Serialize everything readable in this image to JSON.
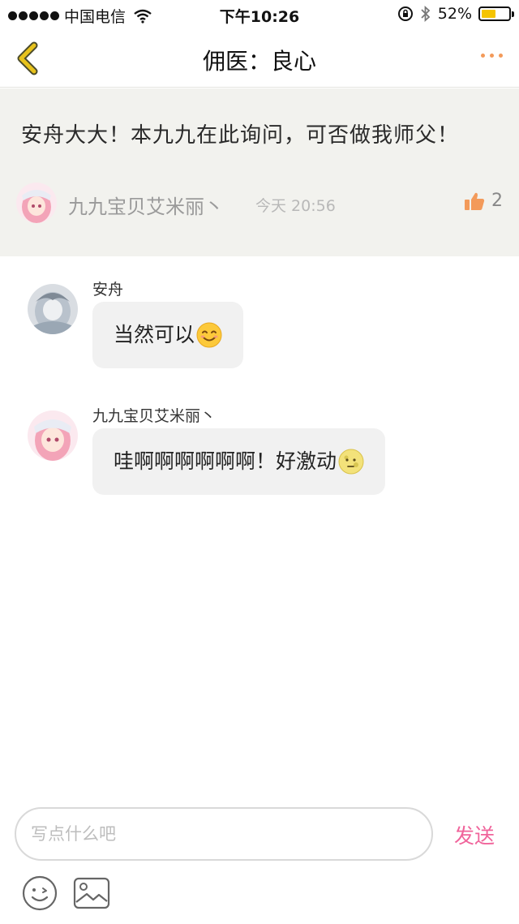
{
  "status_bar": {
    "carrier": "中国电信",
    "time": "下午10:26",
    "battery": "52%",
    "battery_level": 0.52
  },
  "nav": {
    "title": "佣医：良心"
  },
  "post": {
    "text": "安舟大大！本九九在此询问，可否做我师父！",
    "author": "九九宝贝艾米丽丶",
    "time": "今天 20:56",
    "likes": "2"
  },
  "messages": [
    {
      "name": "安舟",
      "text": "当然可以",
      "emoji": "smile-emoji"
    },
    {
      "name": "九九宝贝艾米丽丶",
      "text": "哇啊啊啊啊啊啊！好激动",
      "emoji": "moon-face-emoji"
    }
  ],
  "composer": {
    "placeholder": "写点什么吧",
    "send_label": "发送"
  },
  "icons": {
    "back": "chevron-left-icon",
    "more": "more-dots-icon",
    "like": "thumbs-up-icon",
    "emoji": "emoji-face-icon",
    "image": "image-icon"
  },
  "colors": {
    "accent_orange": "#f39a5a",
    "send_pink": "#f0649b",
    "post_bg": "#f2f2ee",
    "bubble_bg": "#f1f1f1",
    "back_arrow": "#e7c21c"
  }
}
